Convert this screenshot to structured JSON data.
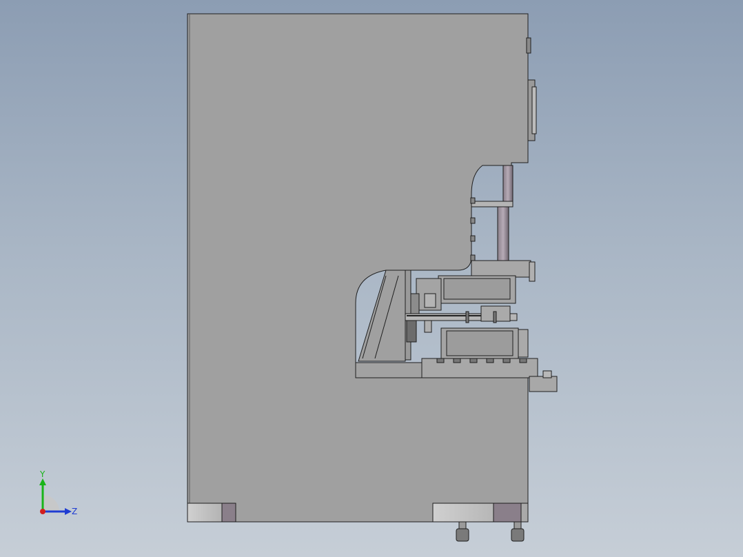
{
  "view": {
    "background_top": "#8c9db3",
    "background_bottom": "#c6ced7",
    "body_color": "#a0a0a0",
    "edge_color": "#1e1e1e"
  },
  "triad": {
    "y_label": "Y",
    "z_label": "Z",
    "y_color": "#19b419",
    "z_color": "#1e3cd2",
    "x_color": "#d21e1e"
  }
}
